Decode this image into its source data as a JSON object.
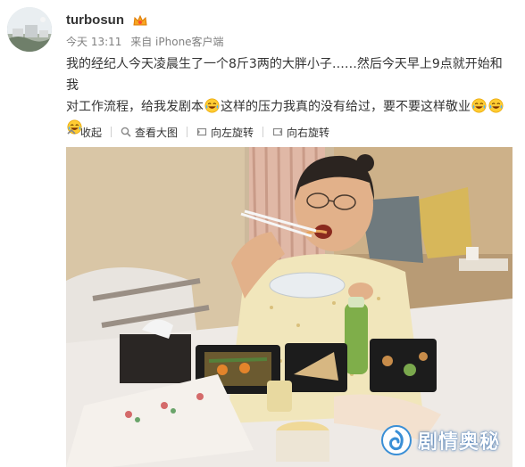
{
  "post": {
    "username": "turbosun",
    "time": "今天 13:11",
    "source": "来自 iPhone客户端",
    "text_line1": "我的经纪人今天凌晨生了一个8斤3两的大胖小子……然后今天早上9点就开始和我",
    "text_line2_a": "对工作流程，给我发剧本",
    "text_line2_b": "这样的压力我真的没有给过，要不要这样敬业",
    "emoji_name": "laugh-cry-emoji"
  },
  "toolbar": {
    "collapse": "收起",
    "view_large": "查看大图",
    "rotate_left": "向左旋转",
    "rotate_right": "向右旋转"
  },
  "watermark": {
    "text": "剧情奥秘"
  },
  "colors": {
    "link": "#333333",
    "meta": "#808080",
    "watermark_blue": "#3a8fd6"
  }
}
